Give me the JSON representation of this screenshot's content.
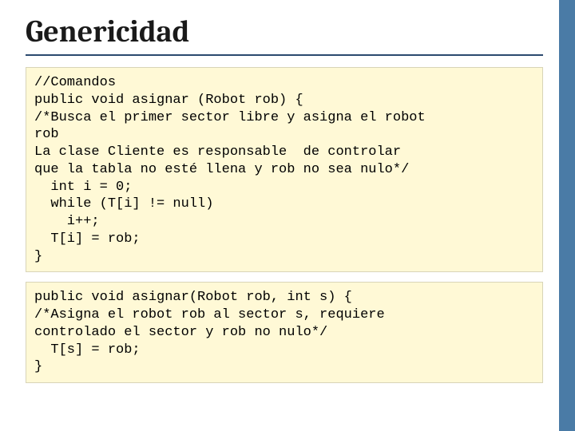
{
  "title": "Genericidad",
  "code_block_1": "//Comandos\npublic void asignar (Robot rob) {\n/*Busca el primer sector libre y asigna el robot\nrob\nLa clase Cliente es responsable  de controlar\nque la tabla no esté llena y rob no sea nulo*/\n  int i = 0;\n  while (T[i] != null)\n    i++;\n  T[i] = rob;\n}",
  "code_block_2": "public void asignar(Robot rob, int s) {\n/*Asigna el robot rob al sector s, requiere\ncontrolado el sector y rob no nulo*/\n  T[s] = rob;\n}"
}
